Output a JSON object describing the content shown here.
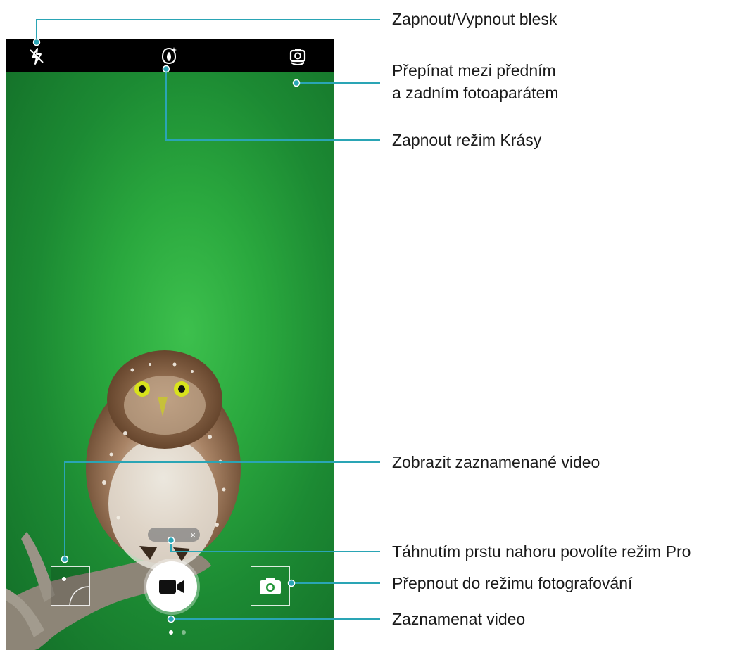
{
  "callouts": {
    "flash": "Zapnout/Vypnout blesk",
    "switch_camera_line1": "Přepínat mezi předním",
    "switch_camera_line2": "a zadním fotoaparátem",
    "beauty": "Zapnout režim Krásy",
    "view_video": "Zobrazit zaznamenané video",
    "pro_mode": "Táhnutím prstu nahoru povolíte režim Pro",
    "photo_mode": "Přepnout do režimu fotografování",
    "record": "Zaznamenat video"
  },
  "pro_hint_close": "×",
  "icons": {
    "flash": "flash-off-icon",
    "beauty": "beauty-mode-icon",
    "switch_camera": "switch-camera-icon",
    "record": "video-camera-icon",
    "photo": "camera-icon"
  },
  "colors": {
    "callout_line": "#2aa5b5",
    "topbar": "#000000",
    "viewfinder_green": "#2aa83e"
  }
}
